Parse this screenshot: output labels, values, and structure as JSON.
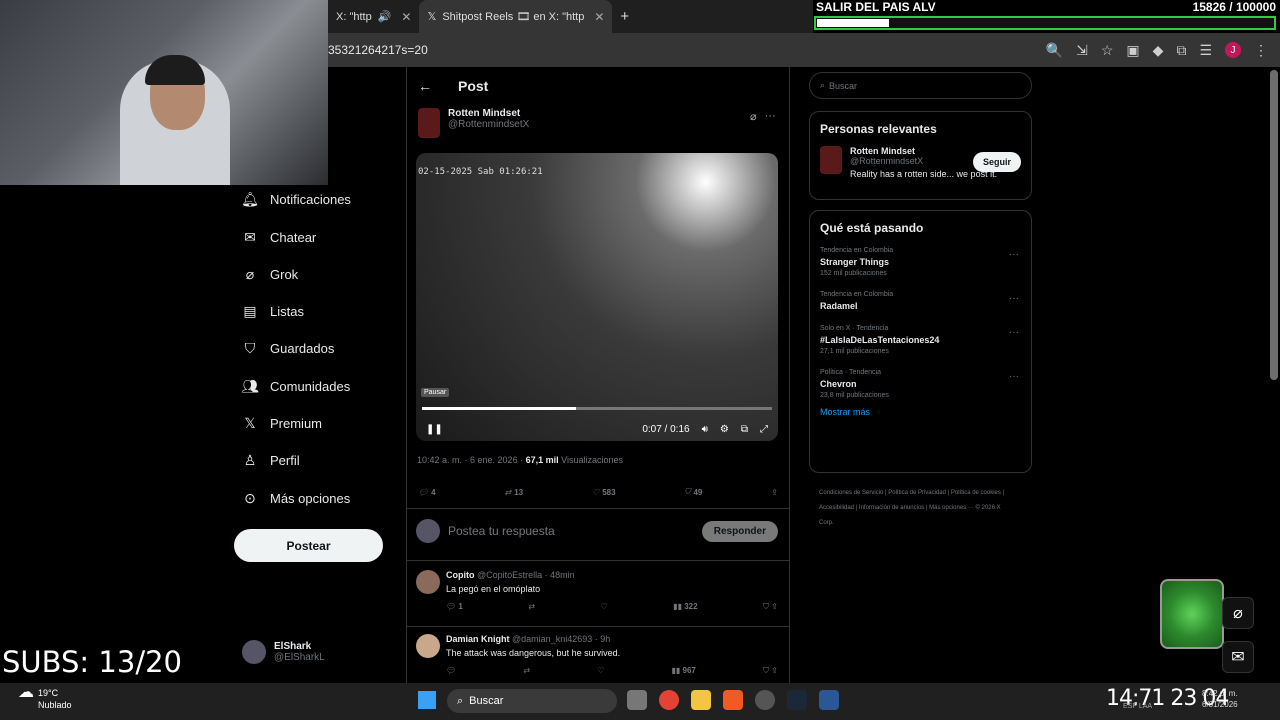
{
  "browser": {
    "tabs": [
      {
        "label": "X: \"http"
      },
      {
        "label": "Shitpost Reels 🎞 en X: \"http"
      }
    ],
    "url": "35321264217s=20"
  },
  "overlay": {
    "goal_title": "SALIR DEL PAIS ALV",
    "goal_count": "15826 / 100000",
    "goal_progress": 0.158,
    "subs": "SUBS: 13/20"
  },
  "nav": {
    "items": [
      {
        "label": "Notificaciones",
        "icon": "bell-icon"
      },
      {
        "label": "Chatear",
        "icon": "mail-icon"
      },
      {
        "label": "Grok",
        "icon": "grok-icon"
      },
      {
        "label": "Listas",
        "icon": "list-icon"
      },
      {
        "label": "Guardados",
        "icon": "bookmark-icon"
      },
      {
        "label": "Comunidades",
        "icon": "people-icon"
      },
      {
        "label": "Premium",
        "icon": "x-icon"
      },
      {
        "label": "Perfil",
        "icon": "person-icon"
      },
      {
        "label": "Más opciones",
        "icon": "more-icon"
      }
    ],
    "post_button": "Postear",
    "me_name": "ElShark",
    "me_handle": "@ElSharkL"
  },
  "post": {
    "header": "Post",
    "author_name": "Rotten Mindset",
    "author_handle": "@RottenmindsetX",
    "video_timestamp": "02-15-2025 Sab 01:26:21",
    "pause_tip": "Pausar",
    "video_time": "0:07 / 0:16",
    "video_progress": 0.44,
    "date": "10:42 a. m. · 6 ene. 2026 ·",
    "views": "67,1 mil",
    "views_label": "Visualizaciones",
    "replies": "4",
    "reposts": "13",
    "likes": "583",
    "bookmarks": "49",
    "reply_placeholder": "Postea tu respuesta",
    "reply_button": "Responder"
  },
  "comments": [
    {
      "name": "Copito",
      "handle": "@CopitoEstrella · 48min",
      "text": "La pegó en el omóplato",
      "replies": "1",
      "views": "322"
    },
    {
      "name": "Damian Knight",
      "handle": "@damian_kni42693 · 9h",
      "text": "The attack was dangerous, but he survived.",
      "replies": "",
      "views": "967"
    }
  ],
  "sidebar": {
    "search_placeholder": "Buscar",
    "relevant_title": "Personas relevantes",
    "relevant": {
      "name": "Rotten Mindset",
      "handle": "@RottenmindsetX",
      "bio": "Reality has a rotten side... we post it.",
      "follow": "Seguir"
    },
    "trends_title": "Qué está pasando",
    "trends": [
      {
        "context": "Tendencia en Colombia",
        "title": "Stranger Things",
        "count": "152 mil publicaciones"
      },
      {
        "context": "Tendencia en Colombia",
        "title": "Radamel",
        "count": ""
      },
      {
        "context": "Solo en X · Tendencia",
        "title": "#LaIslaDeLasTentaciones24",
        "count": "27,1 mil publicaciones"
      },
      {
        "context": "Política · Tendencia",
        "title": "Chevron",
        "count": "23,8 mil publicaciones"
      }
    ],
    "show_more": "Mostrar más",
    "footer": "Condiciones de Servicio | Política de Privacidad | Política de cookies | Accesibilidad | Información de anuncios | Más opciones ··· © 2026 X Corp."
  },
  "taskbar": {
    "weather_temp": "19°C",
    "weather_desc": "Nublado",
    "search": "Buscar",
    "big_clock": "14:71 23 04",
    "lang": "ESP LAA",
    "time": "8:42 p. m.",
    "date": "6/01/2026"
  }
}
